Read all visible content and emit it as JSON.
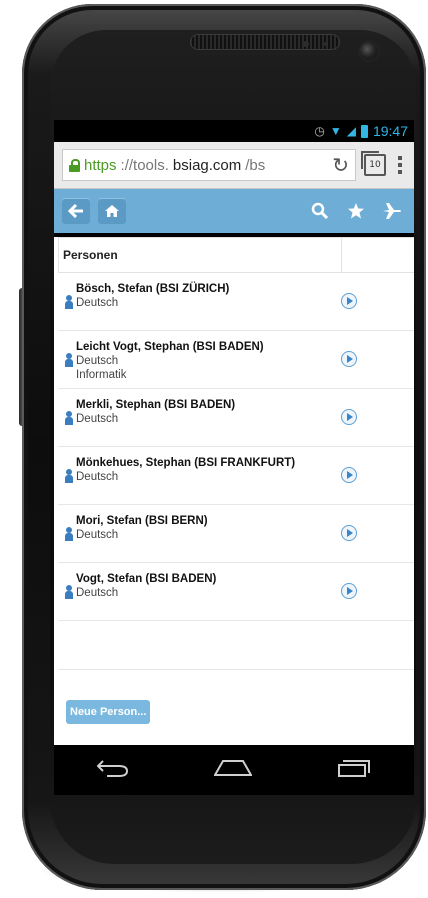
{
  "status_bar": {
    "time": "19:47"
  },
  "browser": {
    "url_scheme": "https",
    "url_sep": "://tools.",
    "url_domain": "bsiag.com",
    "url_tail": "/bs",
    "tab_count": "10"
  },
  "table": {
    "header": "Personen",
    "rows": [
      {
        "name": "Bösch, Stefan (BSI ZÜRICH)",
        "lines": [
          "Deutsch"
        ]
      },
      {
        "name": "Leicht Vogt, Stephan (BSI BADEN)",
        "lines": [
          "Deutsch",
          "Informatik"
        ]
      },
      {
        "name": "Merkli, Stephan (BSI BADEN)",
        "lines": [
          "Deutsch"
        ]
      },
      {
        "name": "Mönkehues, Stephan (BSI FRANKFURT)",
        "lines": [
          "Deutsch"
        ]
      },
      {
        "name": "Mori, Stefan (BSI BERN)",
        "lines": [
          "Deutsch"
        ]
      },
      {
        "name": "Vogt, Stefan (BSI BADEN)",
        "lines": [
          "Deutsch"
        ]
      }
    ]
  },
  "actions": {
    "new_person": "Neue Person..."
  },
  "colors": {
    "toolbar": "#6eaed6",
    "accent": "#3a84c8",
    "secure": "#4a9b24"
  }
}
